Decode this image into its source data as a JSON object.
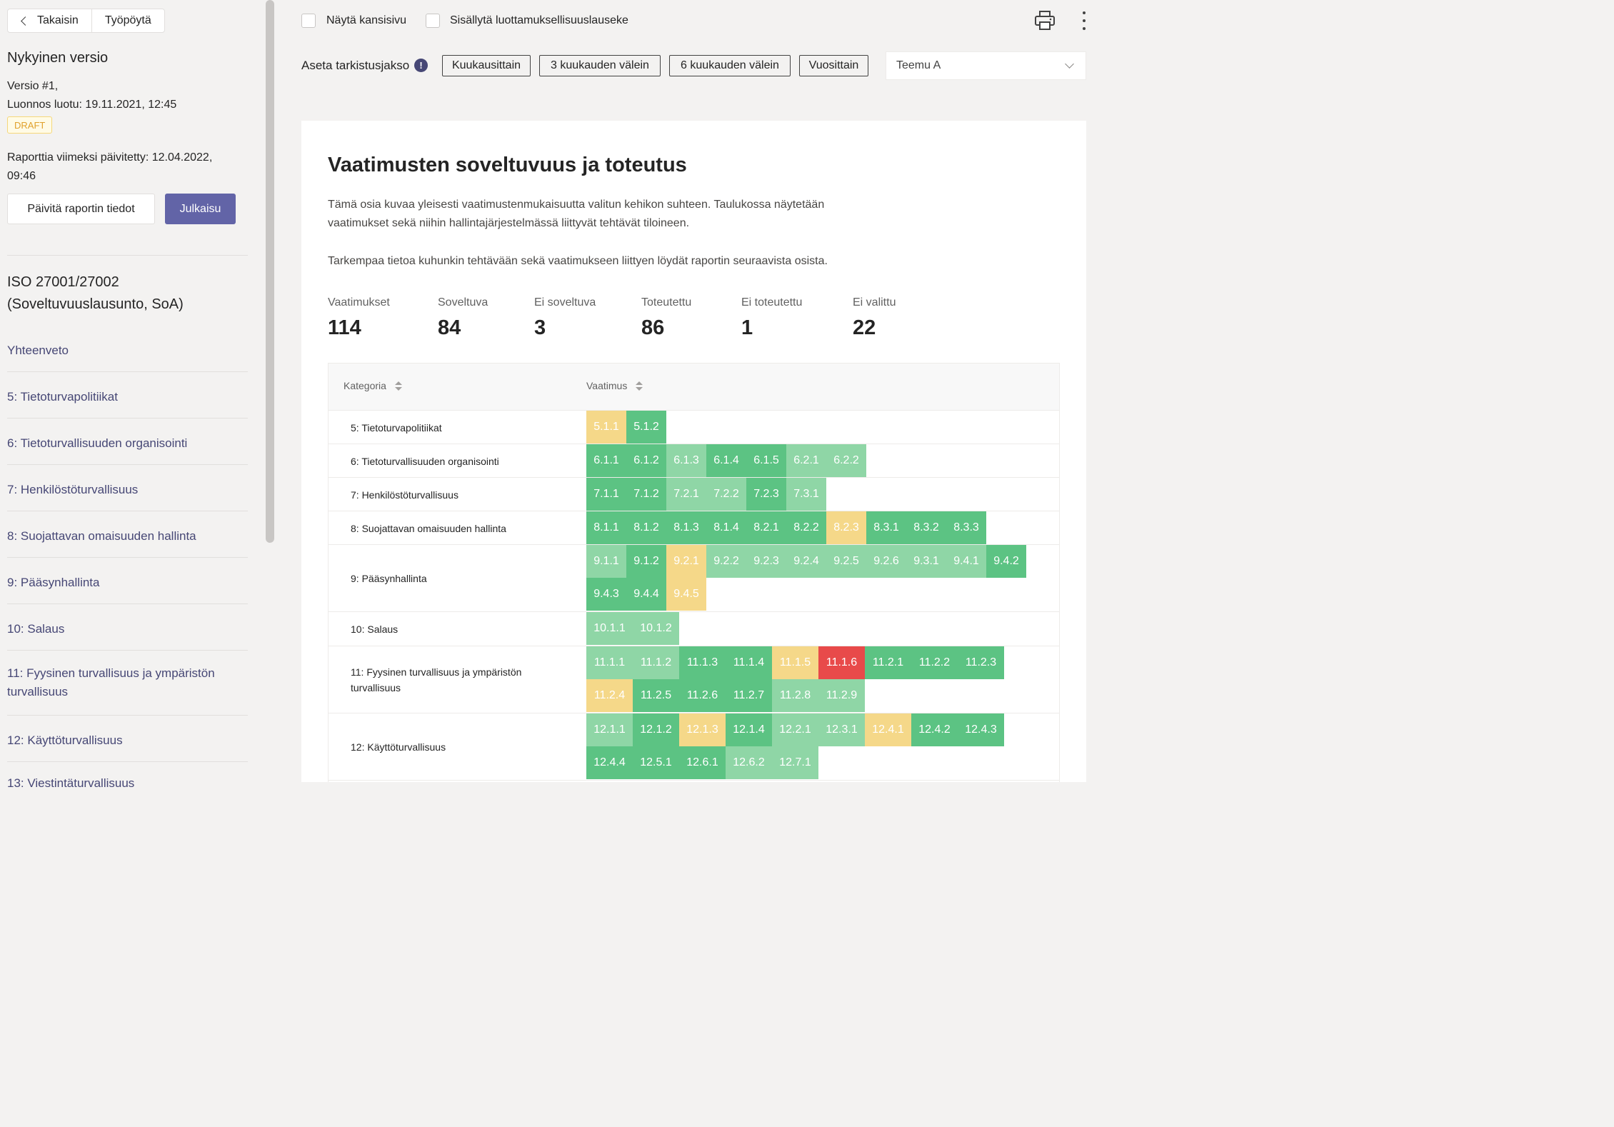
{
  "nav": {
    "back_label": "Takaisin",
    "dashboard_label": "Työpöytä"
  },
  "version": {
    "title": "Nykyinen versio",
    "number": "Versio #1,",
    "draft_created": "Luonnos luotu: 19.11.2021, 12:45",
    "badge": "DRAFT",
    "last_updated_line1": "Raporttia viimeksi päivitetty: 12.04.2022,",
    "last_updated_line2": "09:46",
    "update_button": "Päivitä raportin tiedot",
    "publish_button": "Julkaisu"
  },
  "framework": {
    "line1": "ISO 27001/27002",
    "line2": "(Soveltuvuuslausunto, SoA)"
  },
  "sidebar_nav": [
    {
      "label": "Yhteenveto"
    },
    {
      "label": "5: Tietoturvapolitiikat"
    },
    {
      "label": "6: Tietoturvallisuuden organisointi"
    },
    {
      "label": "7: Henkilöstöturvallisuus"
    },
    {
      "label": "8: Suojattavan omaisuuden hallinta"
    },
    {
      "label": "9: Pääsynhallinta"
    },
    {
      "label": "10: Salaus"
    },
    {
      "label": "11: Fyysinen turvallisuus ja ympäristön turvallisuus"
    },
    {
      "label": "12: Käyttöturvallisuus"
    },
    {
      "label": "13: Viestintäturvallisuus"
    }
  ],
  "options": {
    "show_cover": "Näytä kansisivu",
    "include_confidentiality": "Sisällytä luottamuksellisuuslauseke"
  },
  "review_period": {
    "label": "Aseta tarkistusjakso",
    "options": [
      "Kuukausittain",
      "3 kuukauden välein",
      "6 kuukauden välein",
      "Vuosittain"
    ]
  },
  "user_select": {
    "value": "Teemu A"
  },
  "section": {
    "title": "Vaatimusten soveltuvuus ja toteutus",
    "para1_line1": "Tämä osia kuvaa yleisesti vaatimustenmukaisuutta valitun kehikon suhteen. Taulukossa näytetään",
    "para1_line2": "vaatimukset sekä niihin hallintajärjestelmässä liittyvät tehtävät tiloineen.",
    "para2": "Tarkempaa tietoa kuhunkin tehtävään sekä vaatimukseen liittyen löydät raportin seuraavista osista."
  },
  "stats": [
    {
      "label": "Vaatimukset",
      "value": "114"
    },
    {
      "label": "Soveltuva",
      "value": "84"
    },
    {
      "label": "Ei soveltuva",
      "value": "3"
    },
    {
      "label": "Toteutettu",
      "value": "86"
    },
    {
      "label": "Ei toteutettu",
      "value": "1"
    },
    {
      "label": "Ei valittu",
      "value": "22"
    }
  ],
  "table": {
    "col_category": "Kategoria",
    "col_requirement": "Vaatimus",
    "status_colors": {
      "dark": "#5cc383",
      "light": "#8fd6a6",
      "yellow": "#f5d889",
      "red": "#e84a4a"
    },
    "rows": [
      {
        "category": "5: Tietoturvapolitiikat",
        "reqs": [
          [
            "5.1.1",
            "yellow"
          ],
          [
            "5.1.2",
            "dark"
          ]
        ]
      },
      {
        "category": "6: Tietoturvallisuuden organisointi",
        "reqs": [
          [
            "6.1.1",
            "dark"
          ],
          [
            "6.1.2",
            "dark"
          ],
          [
            "6.1.3",
            "light"
          ],
          [
            "6.1.4",
            "dark"
          ],
          [
            "6.1.5",
            "dark"
          ],
          [
            "6.2.1",
            "light"
          ],
          [
            "6.2.2",
            "light"
          ]
        ]
      },
      {
        "category": "7: Henkilöstöturvallisuus",
        "reqs": [
          [
            "7.1.1",
            "dark"
          ],
          [
            "7.1.2",
            "dark"
          ],
          [
            "7.2.1",
            "light"
          ],
          [
            "7.2.2",
            "light"
          ],
          [
            "7.2.3",
            "dark"
          ],
          [
            "7.3.1",
            "light"
          ]
        ]
      },
      {
        "category": "8: Suojattavan omaisuuden hallinta",
        "reqs": [
          [
            "8.1.1",
            "dark"
          ],
          [
            "8.1.2",
            "dark"
          ],
          [
            "8.1.3",
            "dark"
          ],
          [
            "8.1.4",
            "dark"
          ],
          [
            "8.2.1",
            "dark"
          ],
          [
            "8.2.2",
            "dark"
          ],
          [
            "8.2.3",
            "yellow"
          ],
          [
            "8.3.1",
            "dark"
          ],
          [
            "8.3.2",
            "dark"
          ],
          [
            "8.3.3",
            "dark"
          ]
        ]
      },
      {
        "category": "9: Pääsynhallinta",
        "reqs": [
          [
            "9.1.1",
            "light"
          ],
          [
            "9.1.2",
            "dark"
          ],
          [
            "9.2.1",
            "yellow"
          ],
          [
            "9.2.2",
            "light"
          ],
          [
            "9.2.3",
            "light"
          ],
          [
            "9.2.4",
            "light"
          ],
          [
            "9.2.5",
            "light"
          ],
          [
            "9.2.6",
            "light"
          ],
          [
            "9.3.1",
            "light"
          ],
          [
            "9.4.1",
            "light"
          ],
          [
            "9.4.2",
            "dark"
          ],
          [
            "9.4.3",
            "dark"
          ],
          [
            "9.4.4",
            "dark"
          ],
          [
            "9.4.5",
            "yellow"
          ]
        ]
      },
      {
        "category": "10: Salaus",
        "reqs": [
          [
            "10.1.1",
            "light"
          ],
          [
            "10.1.2",
            "light"
          ]
        ]
      },
      {
        "category": "11: Fyysinen turvallisuus ja ympäristön turvallisuus",
        "reqs": [
          [
            "11.1.1",
            "light"
          ],
          [
            "11.1.2",
            "light"
          ],
          [
            "11.1.3",
            "dark"
          ],
          [
            "11.1.4",
            "dark"
          ],
          [
            "11.1.5",
            "yellow"
          ],
          [
            "11.1.6",
            "red"
          ],
          [
            "11.2.1",
            "dark"
          ],
          [
            "11.2.2",
            "dark"
          ],
          [
            "11.2.3",
            "dark"
          ],
          [
            "11.2.4",
            "yellow"
          ],
          [
            "11.2.5",
            "dark"
          ],
          [
            "11.2.6",
            "dark"
          ],
          [
            "11.2.7",
            "dark"
          ],
          [
            "11.2.8",
            "light"
          ],
          [
            "11.2.9",
            "light"
          ]
        ]
      },
      {
        "category": "12: Käyttöturvallisuus",
        "reqs": [
          [
            "12.1.1",
            "light"
          ],
          [
            "12.1.2",
            "dark"
          ],
          [
            "12.1.3",
            "yellow"
          ],
          [
            "12.1.4",
            "dark"
          ],
          [
            "12.2.1",
            "light"
          ],
          [
            "12.3.1",
            "light"
          ],
          [
            "12.4.1",
            "yellow"
          ],
          [
            "12.4.2",
            "dark"
          ],
          [
            "12.4.3",
            "dark"
          ],
          [
            "12.4.4",
            "dark"
          ],
          [
            "12.5.1",
            "dark"
          ],
          [
            "12.6.1",
            "dark"
          ],
          [
            "12.6.2",
            "light"
          ],
          [
            "12.7.1",
            "light"
          ]
        ]
      }
    ]
  }
}
